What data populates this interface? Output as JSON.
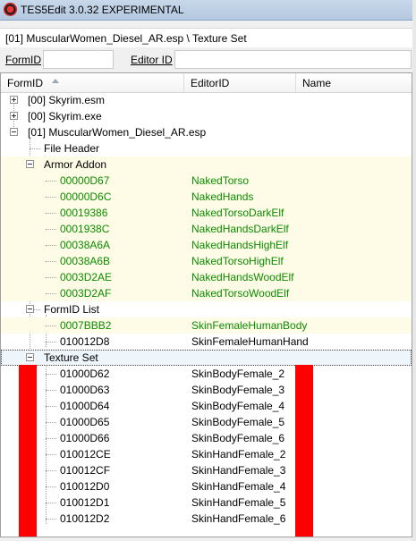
{
  "window": {
    "title": "TES5Edit 3.0.32 EXPERIMENTAL"
  },
  "path_bar": {
    "text": "[01] MuscularWomen_Diesel_AR.esp \\ Texture Set"
  },
  "filter": {
    "formid_label": "FormID",
    "editorid_label": "Editor ID",
    "formid_value": "",
    "editorid_value": ""
  },
  "columns": {
    "formid": "FormID",
    "editorid": "EditorID",
    "name": "Name"
  },
  "tree": {
    "plugin0": "[00] Skyrim.esm",
    "plugin1": "[00] Skyrim.exe",
    "plugin2": "[01] MuscularWomen_Diesel_AR.esp",
    "file_header": "File Header",
    "group_armor": "Armor Addon",
    "group_formid": "FormID List",
    "group_texture": "Texture Set"
  },
  "armor_rows": [
    {
      "formid": "00000D67",
      "editorid": "NakedTorso"
    },
    {
      "formid": "00000D6C",
      "editorid": "NakedHands"
    },
    {
      "formid": "00019386",
      "editorid": "NakedTorsoDarkElf"
    },
    {
      "formid": "0001938C",
      "editorid": "NakedHandsDarkElf"
    },
    {
      "formid": "00038A6A",
      "editorid": "NakedHandsHighElf"
    },
    {
      "formid": "00038A6B",
      "editorid": "NakedTorsoHighElf"
    },
    {
      "formid": "0003D2AE",
      "editorid": "NakedHandsWoodElf"
    },
    {
      "formid": "0003D2AF",
      "editorid": "NakedTorsoWoodElf"
    }
  ],
  "formid_rows": [
    {
      "formid": "0007BBB2",
      "editorid": "SkinFemaleHumanBody"
    },
    {
      "formid": "010012D8",
      "editorid": "SkinFemaleHumanHand"
    }
  ],
  "texture_rows": [
    {
      "formid": "01000D62",
      "editorid": "SkinBodyFemale_2"
    },
    {
      "formid": "01000D63",
      "editorid": "SkinBodyFemale_3"
    },
    {
      "formid": "01000D64",
      "editorid": "SkinBodyFemale_4"
    },
    {
      "formid": "01000D65",
      "editorid": "SkinBodyFemale_5"
    },
    {
      "formid": "01000D66",
      "editorid": "SkinBodyFemale_6"
    },
    {
      "formid": "010012CE",
      "editorid": "SkinHandFemale_2"
    },
    {
      "formid": "010012CF",
      "editorid": "SkinHandFemale_3"
    },
    {
      "formid": "010012D0",
      "editorid": "SkinHandFemale_4"
    },
    {
      "formid": "010012D1",
      "editorid": "SkinHandFemale_5"
    },
    {
      "formid": "010012D2",
      "editorid": "SkinHandFemale_6"
    }
  ],
  "colors": {
    "override_text": "#0b8c00",
    "override_row": "#fefce6",
    "annotation_bar": "#ff0000"
  }
}
